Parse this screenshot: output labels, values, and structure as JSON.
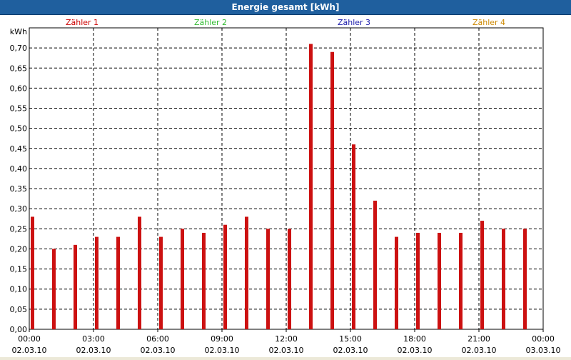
{
  "chart_data": {
    "type": "bar",
    "title": "Energie gesamt [kWh]",
    "ylabel": "kWh",
    "xlabel": "",
    "ylim": [
      0,
      0.75
    ],
    "y_ticks": [
      "0,00",
      "0,05",
      "0,10",
      "0,15",
      "0,20",
      "0,25",
      "0,30",
      "0,35",
      "0,40",
      "0,45",
      "0,50",
      "0,55",
      "0,60",
      "0,65",
      "0,70"
    ],
    "grid": true,
    "legend": [
      {
        "name": "Zähler 1",
        "color": "#cc0000"
      },
      {
        "name": "Zähler 2",
        "color": "#33bb33"
      },
      {
        "name": "Zähler 3",
        "color": "#1a1aaa"
      },
      {
        "name": "Zähler 4",
        "color": "#cc8800"
      }
    ],
    "x_ticks": [
      {
        "time": "00:00",
        "date": "02.03.10"
      },
      {
        "time": "03:00",
        "date": "02.03.10"
      },
      {
        "time": "06:00",
        "date": "02.03.10"
      },
      {
        "time": "09:00",
        "date": "02.03.10"
      },
      {
        "time": "12:00",
        "date": "02.03.10"
      },
      {
        "time": "15:00",
        "date": "02.03.10"
      },
      {
        "time": "18:00",
        "date": "02.03.10"
      },
      {
        "time": "21:00",
        "date": "02.03.10"
      },
      {
        "time": "00:00",
        "date": "03.03.10"
      }
    ],
    "categories": [
      "00:00",
      "01:00",
      "02:00",
      "03:00",
      "04:00",
      "05:00",
      "06:00",
      "07:00",
      "08:00",
      "09:00",
      "10:00",
      "11:00",
      "12:00",
      "13:00",
      "14:00",
      "15:00",
      "16:00",
      "17:00",
      "18:00",
      "19:00",
      "20:00",
      "21:00",
      "22:00",
      "23:00"
    ],
    "series": [
      {
        "name": "Zähler 1",
        "color": "#cc1111",
        "values": [
          0.28,
          0.2,
          0.21,
          0.23,
          0.23,
          0.28,
          0.23,
          0.25,
          0.24,
          0.26,
          0.28,
          0.25,
          0.25,
          0.71,
          0.69,
          0.46,
          0.32,
          0.23,
          0.24,
          0.24,
          0.24,
          0.27,
          0.25,
          0.25
        ]
      }
    ]
  }
}
